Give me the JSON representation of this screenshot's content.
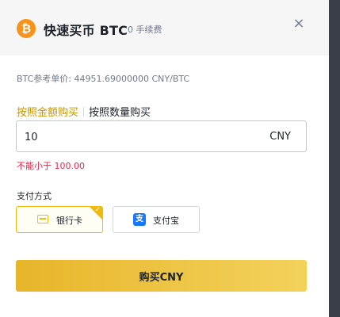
{
  "header": {
    "coin_symbol": "₿",
    "title": "快速买币 BTC",
    "fee_label": "0 手续费",
    "close_symbol": "×"
  },
  "reference_price": "BTC参考单价: 44951.69000000 CNY/BTC",
  "tabs": [
    {
      "label": "按照金额购买",
      "active": true
    },
    {
      "label": "按照数量购买",
      "active": false
    }
  ],
  "amount": {
    "value": "10",
    "currency": "CNY"
  },
  "error_text": "不能小于 100.00",
  "payment": {
    "label": "支付方式",
    "options": [
      {
        "label": "银行卡",
        "icon": "bank-card-icon",
        "selected": true
      },
      {
        "label": "支付宝",
        "icon": "alipay-icon",
        "icon_glyph": "支",
        "selected": false
      }
    ],
    "check_glyph": "✓"
  },
  "buy_button_label": "购买CNY",
  "colors": {
    "accent": "#f0b90b",
    "active_tab": "#c99400",
    "error": "#e0294a",
    "btc": "#f7931a",
    "alipay": "#1677ff"
  }
}
